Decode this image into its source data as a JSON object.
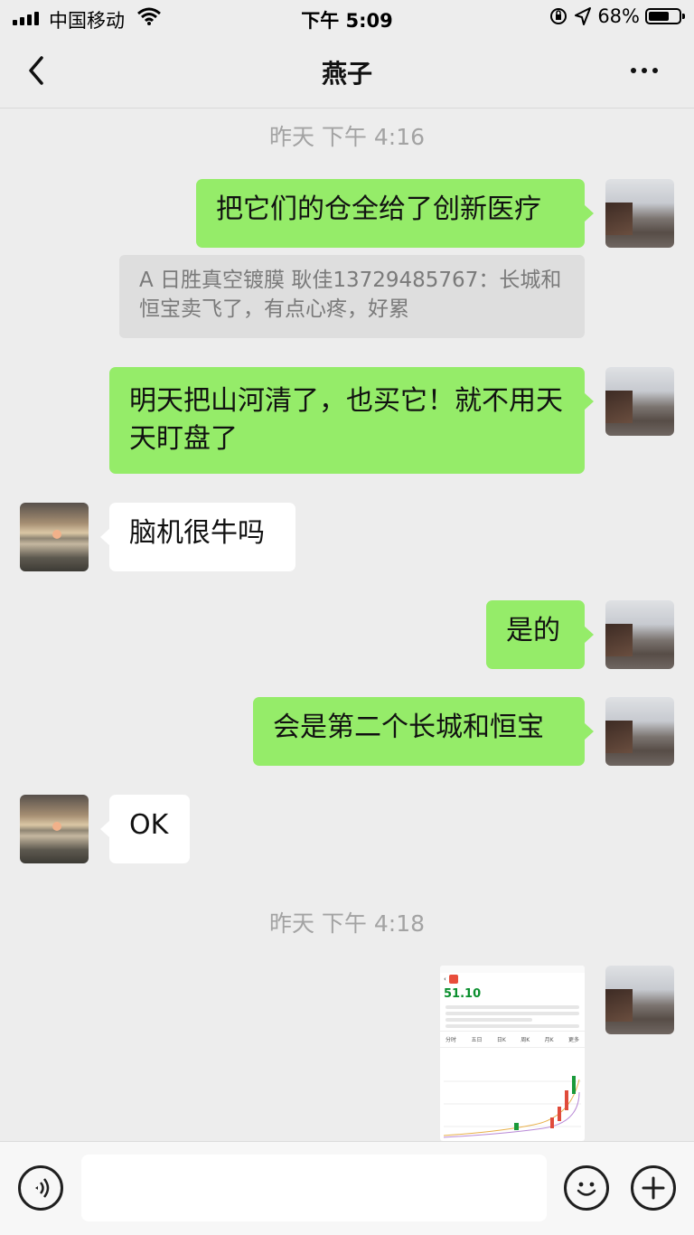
{
  "status_bar": {
    "carrier": "中国移动",
    "time": "下午 5:09",
    "battery_text": "68%",
    "battery_level": 0.68,
    "icons": [
      "signal-icon",
      "wifi-icon",
      "orientation-lock-icon",
      "location-icon",
      "battery-icon"
    ]
  },
  "header": {
    "title": "燕子",
    "back_icon": "chevron-left-icon",
    "more_icon": "more-dots-icon"
  },
  "timestamps": [
    "昨天 下午 4:16",
    "昨天 下午 4:18"
  ],
  "messages": [
    {
      "sender": "me",
      "text": "把它们的仓全给了创新医疗"
    },
    {
      "sender": "me",
      "quote": "A 日胜真空镀膜  耿佳13729485767：长城和恒宝卖飞了，有点心疼，好累"
    },
    {
      "sender": "me",
      "text": "明天把山河清了，也买它！就不用天天盯盘了"
    },
    {
      "sender": "them",
      "text": "脑机很牛吗"
    },
    {
      "sender": "me",
      "text": "是的"
    },
    {
      "sender": "me",
      "text": "会是第二个长城和恒宝"
    },
    {
      "sender": "them",
      "text": "OK"
    },
    {
      "sender": "me",
      "type": "image",
      "image": {
        "title": "",
        "price": "51.10",
        "tabs": [
          "分时",
          "五日",
          "日K",
          "周K",
          "月K",
          "更多"
        ]
      }
    }
  ],
  "input_bar": {
    "placeholder": "",
    "voice_icon": "voice-icon",
    "emoji_icon": "emoji-icon",
    "plus_icon": "plus-icon"
  },
  "colors": {
    "background": "#ededed",
    "my_bubble": "#95ec69",
    "their_bubble": "#ffffff",
    "timestamp": "#a3a3a3"
  }
}
